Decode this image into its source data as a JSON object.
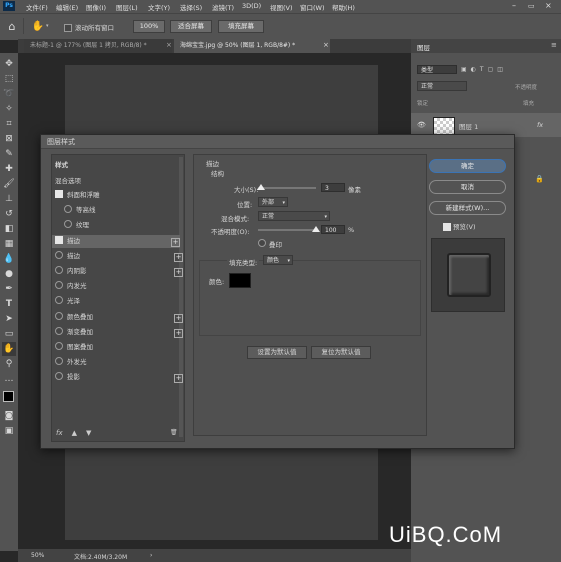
{
  "menubar": {
    "logo": "Ps",
    "items": [
      "文件(F)",
      "编辑(E)",
      "图像(I)",
      "图层(L)",
      "文字(Y)",
      "选择(S)",
      "滤镜(T)",
      "3D(D)",
      "视图(V)",
      "窗口(W)",
      "帮助(H)"
    ]
  },
  "options": {
    "scroll_all_label": "滚动所有窗口",
    "zoom_value": "100%",
    "fit_screen": "适合屏幕",
    "fill_screen": "填充屏幕"
  },
  "tabs": [
    {
      "label": "未标题-1 @ 177% (图层 1 拷贝, RGB/8) *",
      "close": "×"
    },
    {
      "label": "海绵宝宝.jpg @ 50% (图层 1, RGB/8#) *",
      "close": "×"
    }
  ],
  "status": {
    "zoom": "50%",
    "doc": "文档:2.40M/3.20M"
  },
  "layers_panel": {
    "title": "图层",
    "kind": "类型",
    "blend": "正常",
    "opacity": "不透明度",
    "lock": "锁定",
    "fill": "填充",
    "layer_name": "图层 1",
    "fx": "fx"
  },
  "dialog": {
    "title": "图层样式",
    "styles_header": "样式",
    "blend_options": "混合选项",
    "items": [
      {
        "label": "斜面和浮雕",
        "checked": true,
        "plus": false
      },
      {
        "label": "等高线",
        "checked": false,
        "plus": false
      },
      {
        "label": "纹理",
        "checked": false,
        "plus": false
      },
      {
        "label": "描边",
        "checked": true,
        "plus": true
      },
      {
        "label": "描边",
        "checked": false,
        "plus": true
      },
      {
        "label": "内阴影",
        "checked": false,
        "plus": true
      },
      {
        "label": "内发光",
        "checked": false,
        "plus": false
      },
      {
        "label": "光泽",
        "checked": false,
        "plus": false
      },
      {
        "label": "颜色叠加",
        "checked": false,
        "plus": true
      },
      {
        "label": "渐变叠加",
        "checked": false,
        "plus": true
      },
      {
        "label": "图案叠加",
        "checked": false,
        "plus": false
      },
      {
        "label": "外发光",
        "checked": false,
        "plus": false
      },
      {
        "label": "投影",
        "checked": false,
        "plus": true
      }
    ],
    "bottom_icons": [
      "fx",
      "▲",
      "▼",
      "🗑"
    ],
    "section_title": "描边",
    "structure": "结构",
    "size_label": "大小(S):",
    "size_value": "3",
    "size_unit": "像素",
    "size_fraction": 0.05,
    "position_label": "位置:",
    "position_value": "外部",
    "blend_label": "混合模式:",
    "blend_value": "正常",
    "opacity_label": "不透明度(O):",
    "opacity_value": "100",
    "opacity_unit": "%",
    "opacity_fraction": 1.0,
    "overprint": "叠印",
    "fill_type_label": "填充类型:",
    "fill_type_value": "颜色",
    "color_label": "颜色:",
    "color_swatch": "#000000",
    "set_default": "设置为默认值",
    "reset_default": "复位为默认值",
    "ok": "确定",
    "cancel": "取消",
    "new_style": "新建样式(W)...",
    "preview": "预览(V)"
  },
  "watermark": "UiBQ.CoM"
}
